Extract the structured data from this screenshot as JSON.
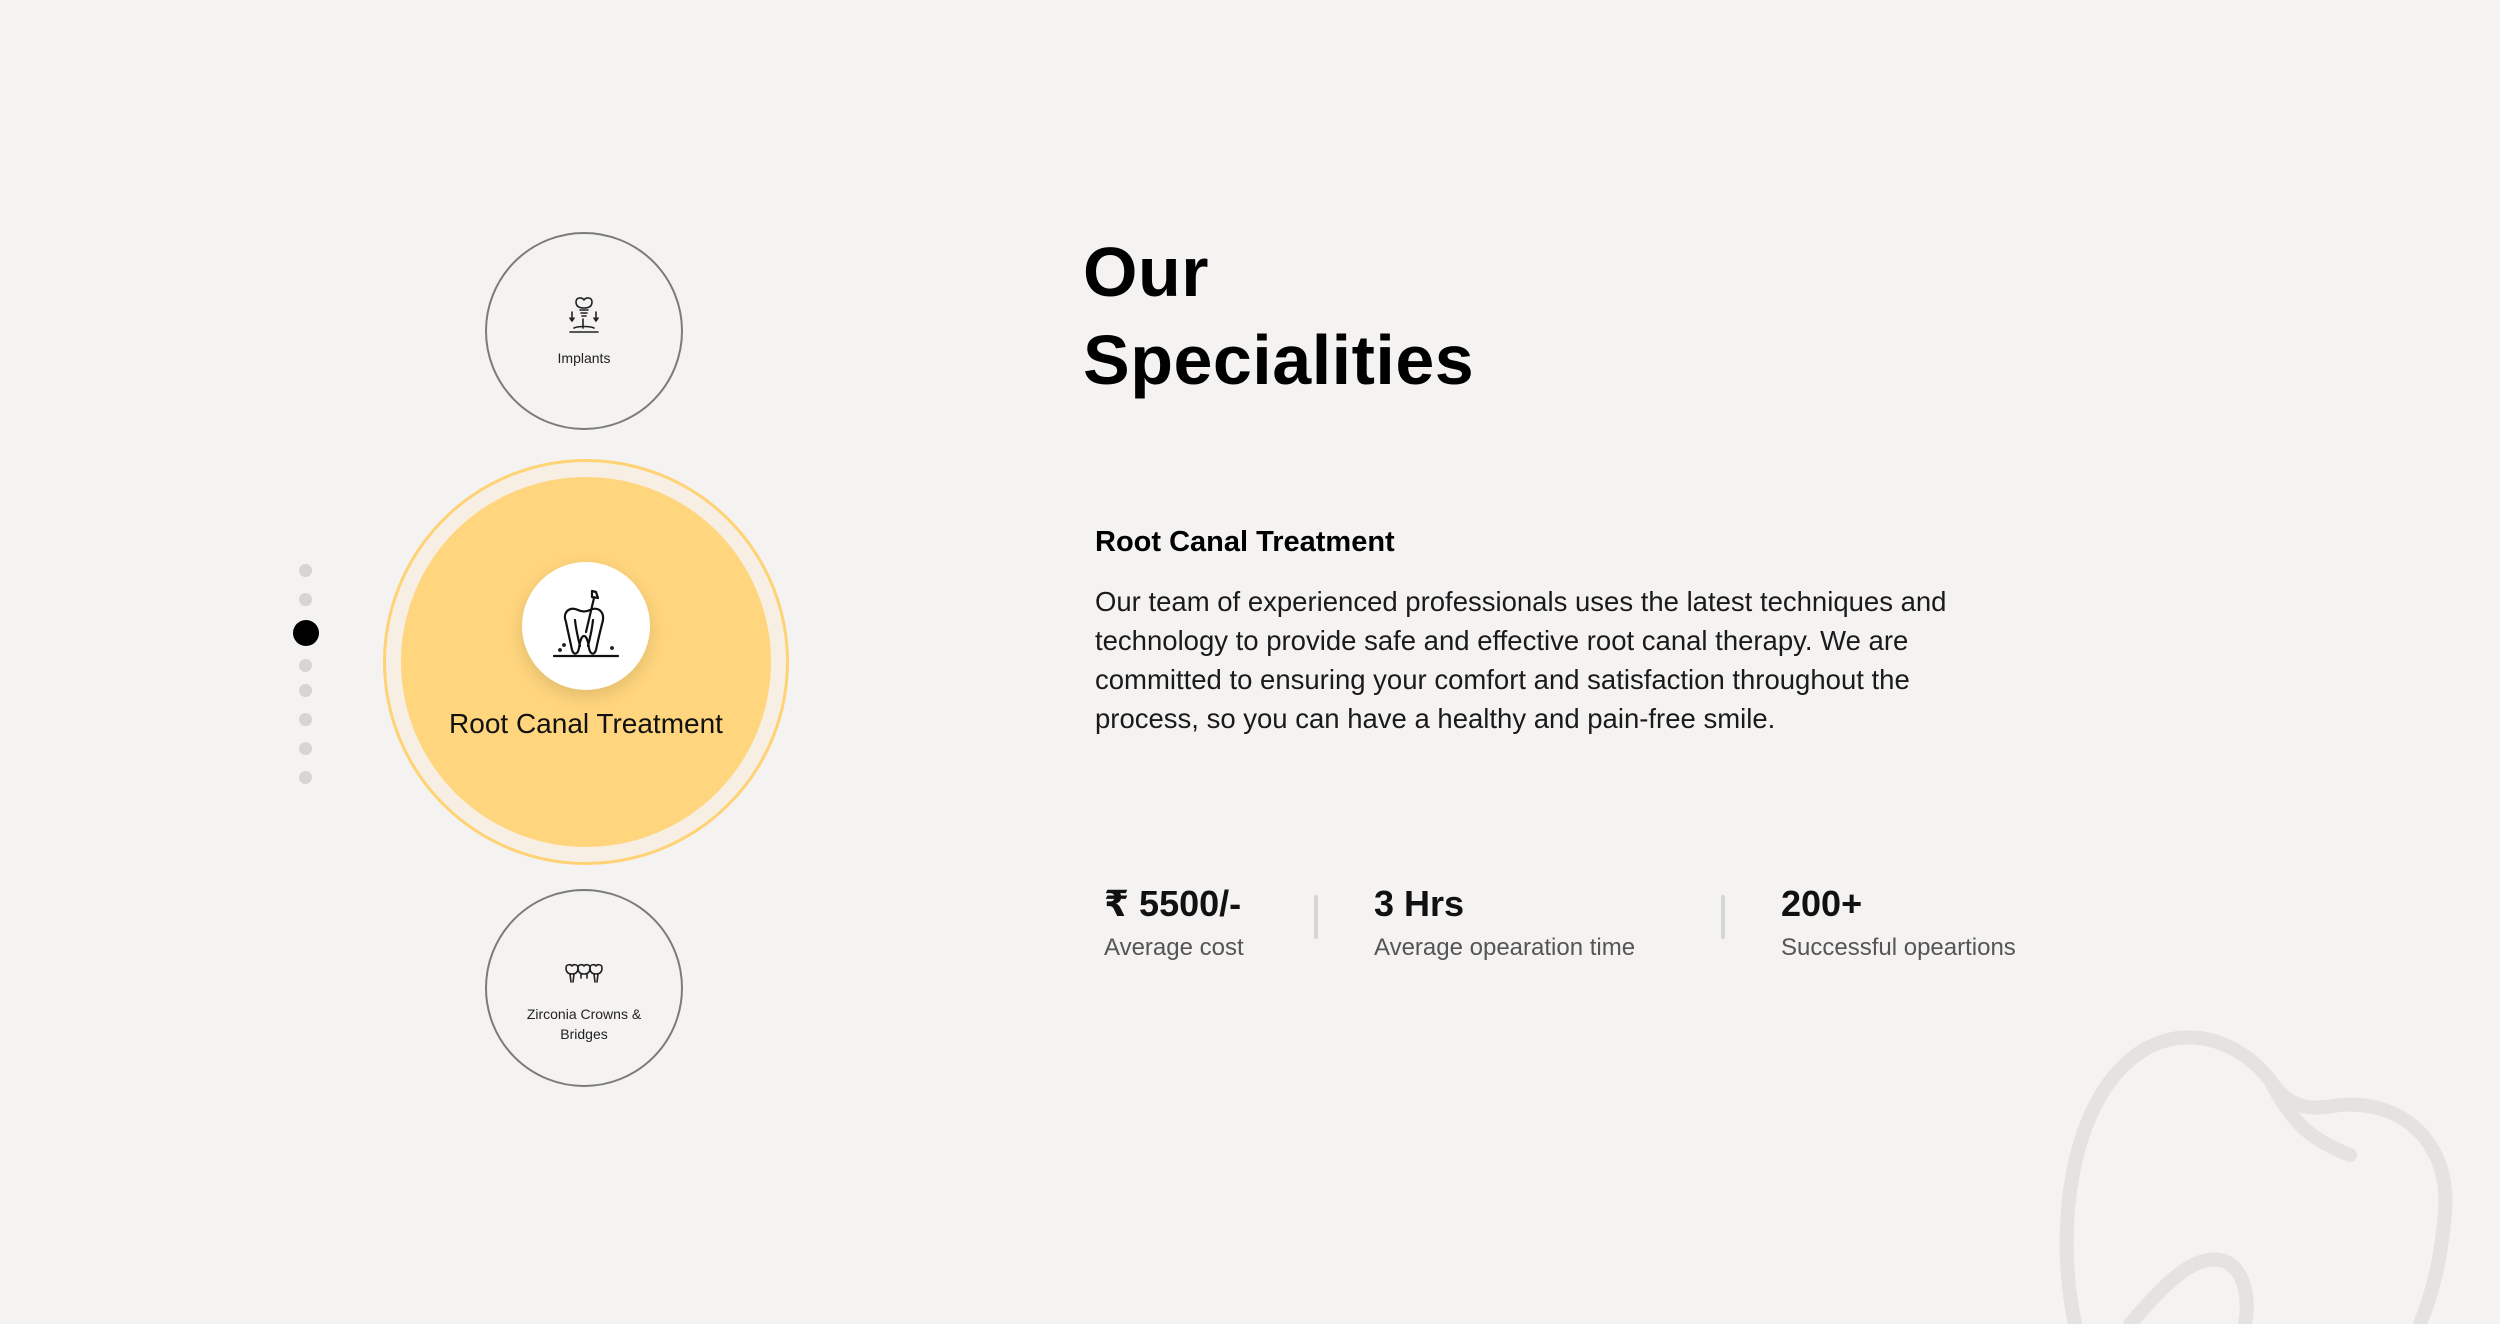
{
  "section": {
    "heading_line1": "Our",
    "heading_line2": "Specialities"
  },
  "carousel": {
    "dots_count": 8,
    "active_dot": 3,
    "prev_item": {
      "label": "Implants",
      "icon": "implant-icon"
    },
    "active_item": {
      "label": "Root Canal Treatment",
      "icon": "root-canal-icon"
    },
    "next_item": {
      "label": "Zirconia Crowns & Bridges",
      "icon": "crowns-bridges-icon"
    }
  },
  "detail": {
    "title": "Root Canal Treatment",
    "description": "Our team of experienced professionals uses the latest techniques and technology to provide safe and effective root canal therapy. We are committed to ensuring your comfort and satisfaction throughout the process, so you can have a healthy and pain-free smile."
  },
  "stats": [
    {
      "value": "₹ 5500/-",
      "caption": "Average cost"
    },
    {
      "value": "3 Hrs",
      "caption": "Average opearation time"
    },
    {
      "value": "200+",
      "caption": "Successful opeartions"
    }
  ],
  "colors": {
    "background": "#f4f3f1",
    "accent": "#ffd57d",
    "accent_ring": "#ffd375",
    "active_dot": "#000000",
    "inactive_dot": "#d6d5d3"
  }
}
